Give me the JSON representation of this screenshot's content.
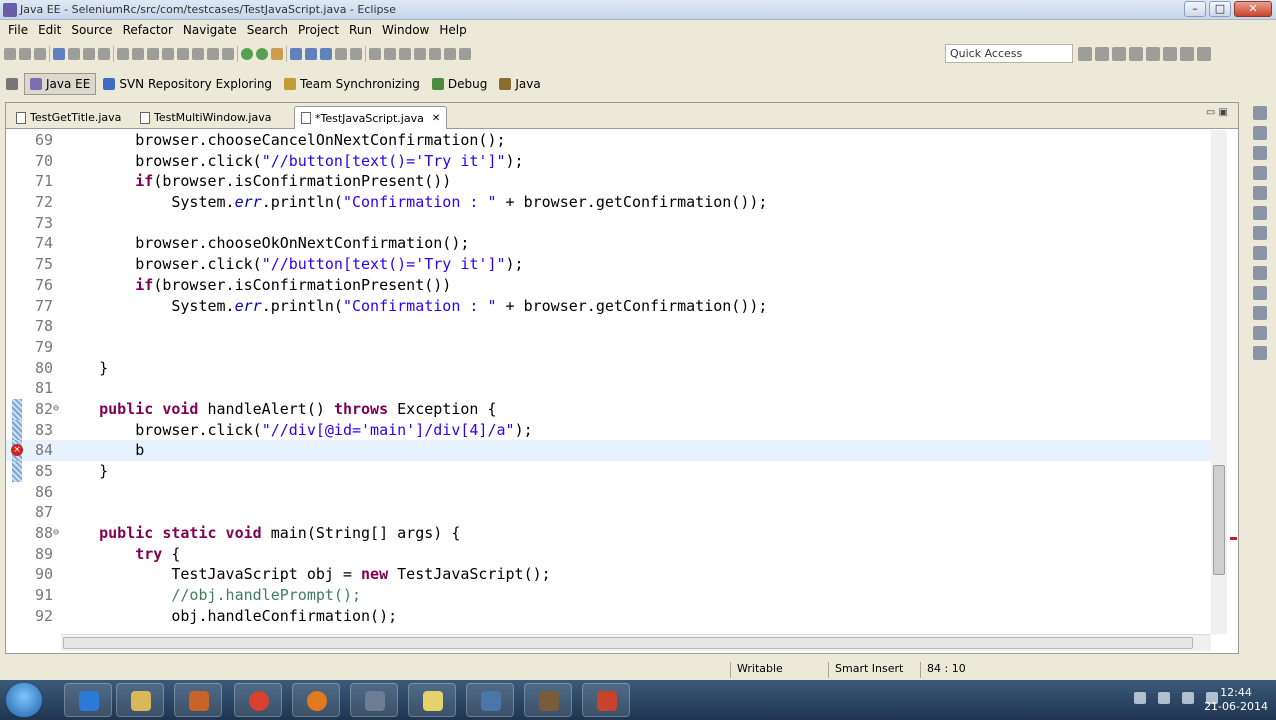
{
  "window": {
    "title": "Java EE - SeleniumRc/src/com/testcases/TestJavaScript.java - Eclipse",
    "min": "–",
    "max": "□",
    "close": "✕"
  },
  "menu": [
    "File",
    "Edit",
    "Source",
    "Refactor",
    "Navigate",
    "Search",
    "Project",
    "Run",
    "Window",
    "Help"
  ],
  "quick_access": {
    "placeholder": "Quick Access"
  },
  "perspectives": [
    {
      "label": "Java EE",
      "active": true
    },
    {
      "label": "SVN Repository Exploring"
    },
    {
      "label": "Team Synchronizing"
    },
    {
      "label": "Debug"
    },
    {
      "label": "Java"
    }
  ],
  "tabs": [
    {
      "label": "TestGetTitle.java"
    },
    {
      "label": "TestMultiWindow.java"
    },
    {
      "label": "*TestJavaScript.java",
      "active": true,
      "close": "✕"
    }
  ],
  "editor_controls": "▭ ▣",
  "code": [
    {
      "n": "69",
      "html": "        browser.chooseCancelOnNextConfirmation();"
    },
    {
      "n": "70",
      "html": "        browser.click(<span class='s'>\"//button[text()='Try it']\"</span>);"
    },
    {
      "n": "71",
      "html": "        <span class='k'>if</span>(browser.isConfirmationPresent())"
    },
    {
      "n": "72",
      "html": "            System.<span class='f'>err</span>.println(<span class='s'>\"Confirmation : \"</span> + browser.getConfirmation());"
    },
    {
      "n": "73",
      "html": ""
    },
    {
      "n": "74",
      "html": "        browser.chooseOkOnNextConfirmation();"
    },
    {
      "n": "75",
      "html": "        browser.click(<span class='s'>\"//button[text()='Try it']\"</span>);"
    },
    {
      "n": "76",
      "html": "        <span class='k'>if</span>(browser.isConfirmationPresent())"
    },
    {
      "n": "77",
      "html": "            System.<span class='f'>err</span>.println(<span class='s'>\"Confirmation : \"</span> + browser.getConfirmation());"
    },
    {
      "n": "78",
      "html": ""
    },
    {
      "n": "79",
      "html": ""
    },
    {
      "n": "80",
      "html": "    }"
    },
    {
      "n": "81",
      "html": ""
    },
    {
      "n": "82",
      "fold": "⊖",
      "marker": true,
      "html": "    <span class='k'>public void</span> handleAlert() <span class='k'>throws</span> Exception {"
    },
    {
      "n": "83",
      "marker": true,
      "html": "        browser.click(<span class='s'>\"//div[@id='main']/div[4]/a\"</span>);"
    },
    {
      "n": "84",
      "error": true,
      "current": true,
      "html": "        b"
    },
    {
      "n": "85",
      "marker": true,
      "html": "    }"
    },
    {
      "n": "86",
      "html": ""
    },
    {
      "n": "87",
      "html": ""
    },
    {
      "n": "88",
      "fold": "⊖",
      "html": "    <span class='k'>public static void</span> main(String[] args) {"
    },
    {
      "n": "89",
      "html": "        <span class='k'>try</span> {"
    },
    {
      "n": "90",
      "html": "            TestJavaScript obj = <span class='k'>new</span> TestJavaScript();"
    },
    {
      "n": "91",
      "html": "            <span class='c'>//obj.handlePrompt();</span>"
    },
    {
      "n": "92",
      "html": "            obj.handleConfirmation();"
    }
  ],
  "status": {
    "writable": "Writable",
    "insert": "Smart Insert",
    "position": "84 : 10"
  },
  "taskbar": {
    "time": "12:44",
    "date": "21-06-2014"
  }
}
